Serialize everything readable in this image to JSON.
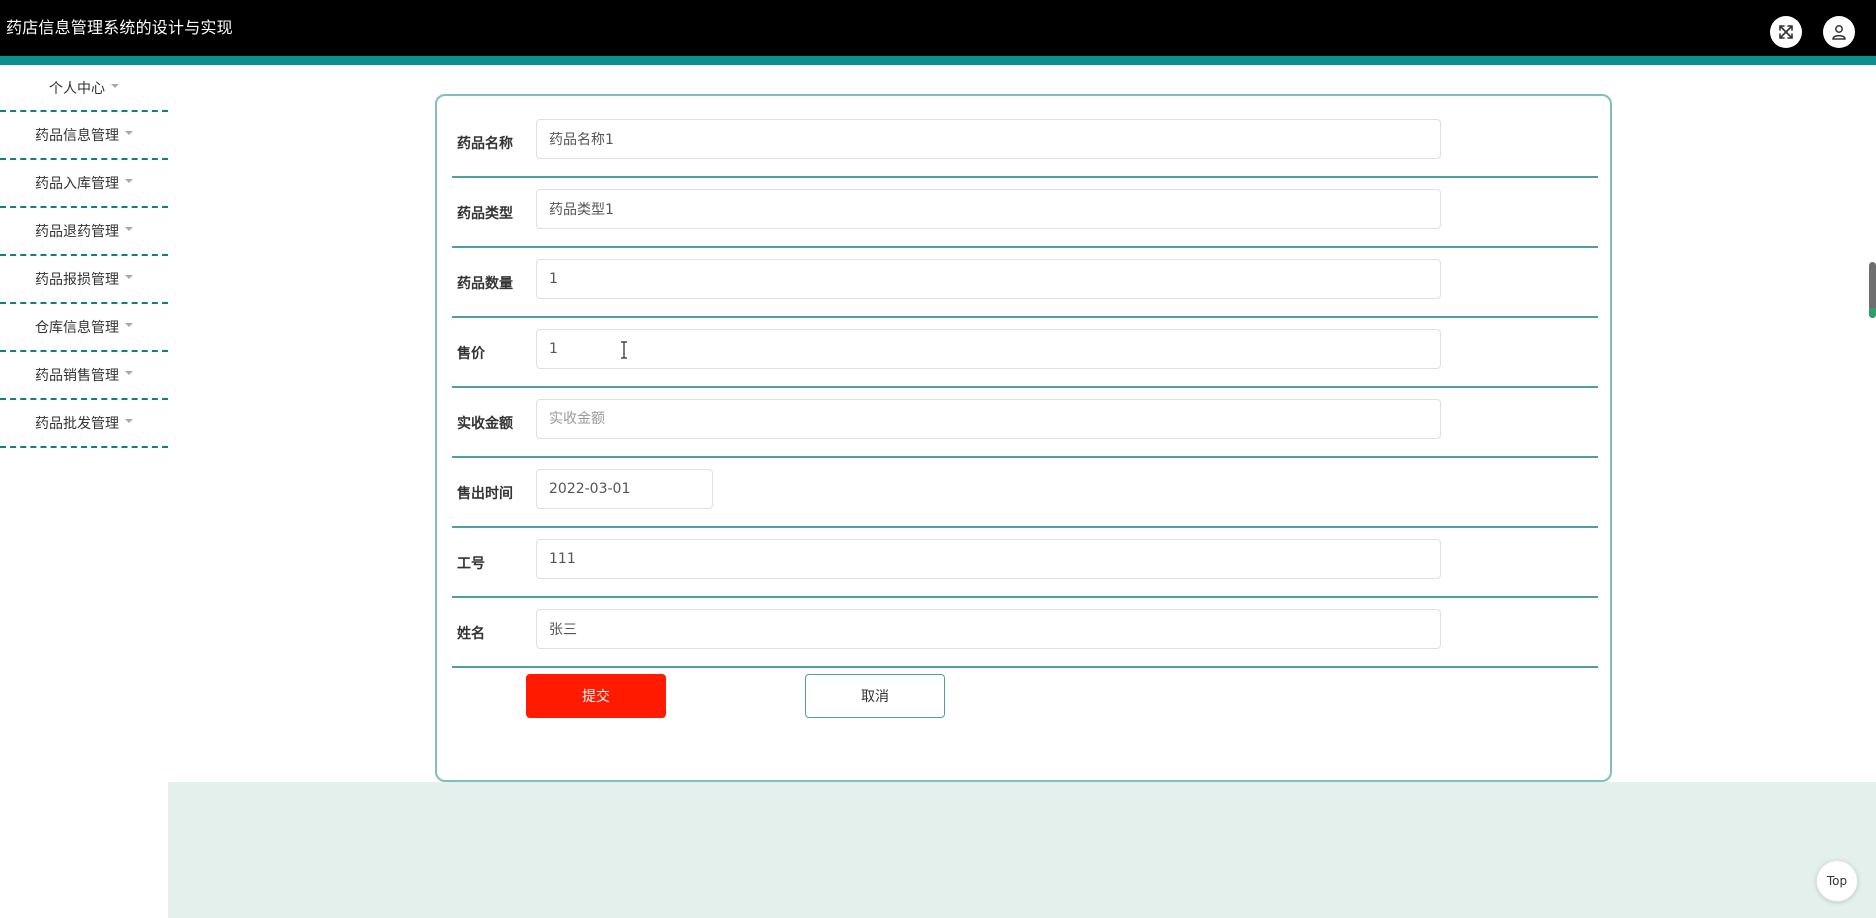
{
  "header": {
    "title": "药店信息管理系统的设计与实现",
    "icons": [
      "fullscreen-icon",
      "user-icon"
    ]
  },
  "sidebar": {
    "items": [
      {
        "label": "个人中心"
      },
      {
        "label": "药品信息管理"
      },
      {
        "label": "药品入库管理"
      },
      {
        "label": "药品退药管理"
      },
      {
        "label": "药品报损管理"
      },
      {
        "label": "仓库信息管理"
      },
      {
        "label": "药品销售管理"
      },
      {
        "label": "药品批发管理"
      }
    ]
  },
  "form": {
    "fields": [
      {
        "label": "药品名称",
        "value": "药品名称1",
        "placeholder": "药品名称"
      },
      {
        "label": "药品类型",
        "value": "药品类型1",
        "placeholder": "药品类型"
      },
      {
        "label": "药品数量",
        "value": "1",
        "placeholder": "药品数量"
      },
      {
        "label": "售价",
        "value": "1",
        "placeholder": "售价"
      },
      {
        "label": "实收金额",
        "value": "",
        "placeholder": "实收金额"
      },
      {
        "label": "售出时间",
        "value": "2022-03-01",
        "placeholder": "售出时间"
      },
      {
        "label": "工号",
        "value": "111",
        "placeholder": "工号"
      },
      {
        "label": "姓名",
        "value": "张三",
        "placeholder": "姓名"
      }
    ],
    "submit_label": "提交",
    "cancel_label": "取消"
  },
  "back_to_top_label": "Top",
  "colors": {
    "header_bg": "#000000",
    "accent": "#0e8f8f",
    "submit": "#ff1a00",
    "card_border": "#7fbfc3",
    "footer_bg": "#e3f0ec"
  }
}
